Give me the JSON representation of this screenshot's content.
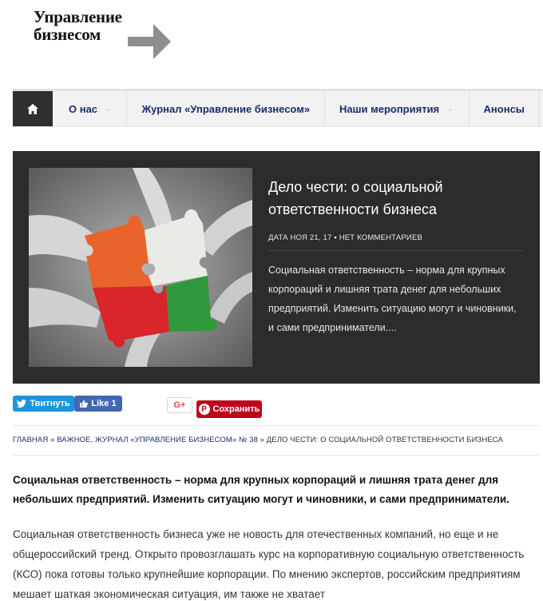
{
  "logo": {
    "line1": "Управление",
    "line2": "бизнесом"
  },
  "nav": {
    "home_icon": "home-icon",
    "items": [
      {
        "label": "О нас",
        "has_caret": true
      },
      {
        "label": "Журнал «Управление бизнесом»",
        "has_caret": false
      },
      {
        "label": "Наши мероприятия",
        "has_caret": true
      },
      {
        "label": "Анонсы",
        "has_caret": false
      }
    ],
    "caret": "⌄"
  },
  "feature": {
    "title": "Дело чести: о социальной ответственности бизнеса",
    "meta_date_label": "ДАТА",
    "meta_date": "НОЯ 21, 17",
    "meta_sep": "•",
    "meta_comments": "НЕТ КОММЕНТАРИЕВ",
    "excerpt": "Социальная ответственность – норма для крупных корпораций и лишняя трата денег для небольших предприятий. Изменить ситуацию могут и чиновники, и сами предприниматели...."
  },
  "share": {
    "tweet": "Твитнуть",
    "like": "Like 1",
    "gplus": "G+",
    "pin": "Сохранить",
    "colors": {
      "twitter": "#1b95e0",
      "facebook": "#4267b2",
      "pinterest": "#bd081c",
      "gplus": "#dd4b39"
    }
  },
  "breadcrumb": {
    "home": "ГЛАВНАЯ",
    "sep": "»",
    "cat1": "ВАЖНОЕ",
    "cat2": "ЖУРНАЛ «УПРАВЛЕНИЕ БИЗНЕСОМ» № 38",
    "current": "ДЕЛО ЧЕСТИ: О СОЦИАЛЬНОЙ ОТВЕТСТВЕННОСТИ БИЗНЕСА"
  },
  "article": {
    "lead": "Социальная ответственность – норма для крупных корпораций и лишняя трата денег для небольших предприятий. Изменить ситуацию могут и чиновники, и сами предприниматели.",
    "body": "Социальная ответственность бизнеса уже не новость для отечественных компаний, но еще и не общероссийский тренд. Открыто провозглашать курс на корпоративную социальную ответственность (КСО) пока готовы только крупнейшие корпорации. По мнению экспертов, российским предприятиям мешает шаткая экономическая ситуация, им также не хватает"
  }
}
